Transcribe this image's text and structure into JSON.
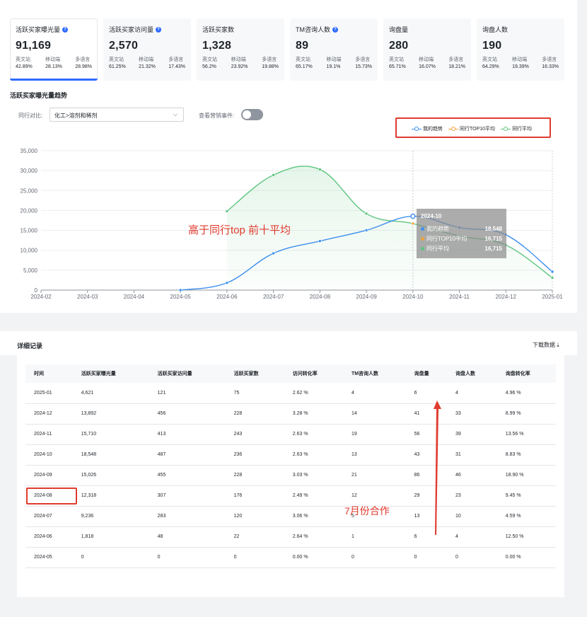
{
  "metrics": [
    {
      "title": "活跃买家曝光量",
      "info": true,
      "value": "91,169",
      "subs": [
        {
          "label": "英文站",
          "value": "42.89%"
        },
        {
          "label": "移动端",
          "value": "28.13%"
        },
        {
          "label": "多语言",
          "value": "28.98%"
        }
      ]
    },
    {
      "title": "活跃买家访问量",
      "info": true,
      "value": "2,570",
      "subs": [
        {
          "label": "英文站",
          "value": "61.25%"
        },
        {
          "label": "移动端",
          "value": "21.32%"
        },
        {
          "label": "多语言",
          "value": "17.43%"
        }
      ]
    },
    {
      "title": "活跃买家数",
      "info": false,
      "value": "1,328",
      "subs": [
        {
          "label": "英文站",
          "value": "56.2%"
        },
        {
          "label": "移动端",
          "value": "23.92%"
        },
        {
          "label": "多语言",
          "value": "19.88%"
        }
      ]
    },
    {
      "title": "TM咨询人数",
      "info": true,
      "value": "89",
      "subs": [
        {
          "label": "英文站",
          "value": "65.17%"
        },
        {
          "label": "移动端",
          "value": "19.1%"
        },
        {
          "label": "多语言",
          "value": "15.73%"
        }
      ]
    },
    {
      "title": "询盘量",
      "info": false,
      "value": "280",
      "subs": [
        {
          "label": "英文站",
          "value": "65.71%"
        },
        {
          "label": "移动端",
          "value": "16.07%"
        },
        {
          "label": "多语言",
          "value": "18.21%"
        }
      ]
    },
    {
      "title": "询盘人数",
      "info": false,
      "value": "190",
      "subs": [
        {
          "label": "英文站",
          "value": "64.29%"
        },
        {
          "label": "移动端",
          "value": "19.39%"
        },
        {
          "label": "多语言",
          "value": "16.33%"
        }
      ]
    }
  ],
  "trend": {
    "title": "活跃买家曝光量趋势",
    "compare_label": "同行对比:",
    "compare_value": "化工>溶剂和稀剂",
    "event_label": "查看营销事件:",
    "event_toggle": false,
    "annotation": "高于同行top 前十平均"
  },
  "chart_data": {
    "type": "line",
    "categories": [
      "2024-02",
      "2024-03",
      "2024-04",
      "2024-05",
      "2024-06",
      "2024-07",
      "2024-08",
      "2024-09",
      "2024-10",
      "2024-11",
      "2024-12",
      "2025-01"
    ],
    "y_ticks": [
      "0",
      "5,000",
      "10,000",
      "15,000",
      "20,000",
      "25,000",
      "30,000",
      "35,000"
    ],
    "ylim": [
      0,
      35000
    ],
    "grid": true,
    "legend_position": "top-right",
    "series": [
      {
        "name": "我的趋势",
        "color": "#3d8ff0",
        "values": [
          null,
          null,
          null,
          0,
          1818,
          9236,
          12318,
          15026,
          18548,
          15710,
          13892,
          4621
        ]
      },
      {
        "name": "同行TOP10平均",
        "color": "#f0a23a",
        "values": [
          null,
          null,
          null,
          null,
          null,
          null,
          null,
          null,
          16715,
          null,
          null,
          null
        ]
      },
      {
        "name": "同行平均",
        "color": "#5ec47e",
        "values": [
          null,
          null,
          null,
          null,
          19800,
          28900,
          30300,
          19200,
          16715,
          13600,
          11300,
          3100
        ]
      }
    ],
    "tooltip": {
      "date": "2024-10",
      "rows": [
        {
          "name": "我的趋势",
          "value": "18,548",
          "color": "#3d8ff0"
        },
        {
          "name": "同行TOP10平均",
          "value": "16,715",
          "color": "#f0a23a"
        },
        {
          "name": "同行平均",
          "value": "16,715",
          "color": "#5ec47e"
        }
      ]
    }
  },
  "details": {
    "title": "详细记录",
    "download_label": "下载数据 ⤓",
    "columns": [
      "时间",
      "活跃买家曝光量",
      "活跃买家访问量",
      "活跃买家数",
      "访问转化率",
      "TM咨询人数",
      "询盘量",
      "询盘人数",
      "询盘转化率"
    ],
    "rows": [
      [
        "2025-01",
        "4,621",
        "121",
        "75",
        "2.62 %",
        "4",
        "6",
        "4",
        "4.96 %"
      ],
      [
        "2024-12",
        "13,892",
        "456",
        "228",
        "3.28 %",
        "14",
        "41",
        "33",
        "8.99 %"
      ],
      [
        "2024-11",
        "15,710",
        "413",
        "243",
        "2.63 %",
        "19",
        "56",
        "39",
        "13.56 %"
      ],
      [
        "2024-10",
        "18,548",
        "487",
        "236",
        "2.63 %",
        "13",
        "43",
        "31",
        "8.83 %"
      ],
      [
        "2024-09",
        "15,026",
        "455",
        "228",
        "3.03 %",
        "21",
        "86",
        "46",
        "18.90 %"
      ],
      [
        "2024-08",
        "12,318",
        "307",
        "176",
        "2.49 %",
        "12",
        "29",
        "23",
        "9.45 %"
      ],
      [
        "2024-07",
        "9,236",
        "283",
        "120",
        "3.06 %",
        "5",
        "13",
        "10",
        "4.59 %"
      ],
      [
        "2024-06",
        "1,818",
        "48",
        "22",
        "2.64 %",
        "1",
        "6",
        "4",
        "12.50 %"
      ],
      [
        "2024-05",
        "0",
        "0",
        "0",
        "0.00 %",
        "0",
        "0",
        "0",
        "0.00 %"
      ]
    ],
    "annotation": "7月份合作"
  },
  "colors": {
    "accent": "#2f6bff",
    "annotation": "#e03b2f"
  }
}
